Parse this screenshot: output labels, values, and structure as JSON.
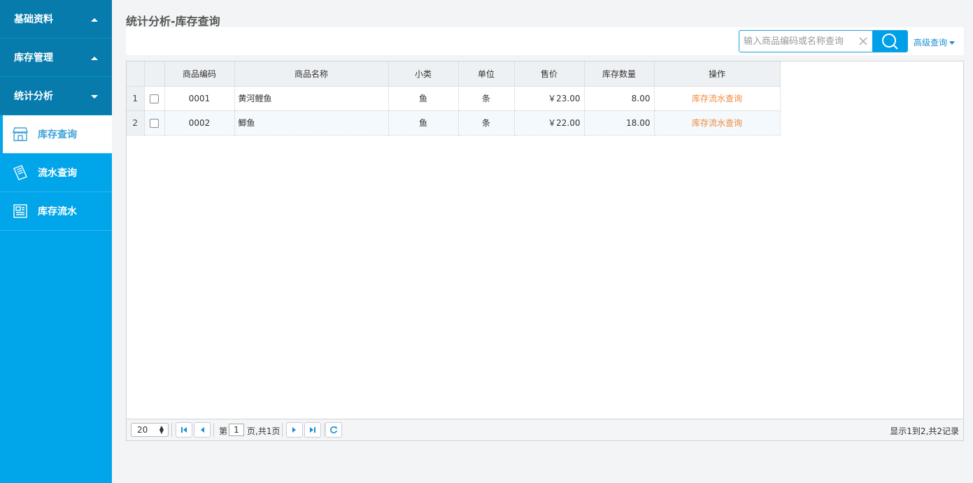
{
  "sidebar": {
    "groups": [
      {
        "label": "基础资料"
      },
      {
        "label": "库存管理"
      },
      {
        "label": "统计分析"
      }
    ],
    "items": [
      {
        "label": "库存查询"
      },
      {
        "label": "流水查询"
      },
      {
        "label": "库存流水"
      }
    ]
  },
  "page": {
    "title": "统计分析-库存查询"
  },
  "search": {
    "placeholder": "输入商品编码或名称查询",
    "advanced_label": "高级查询"
  },
  "table": {
    "headers": [
      "商品编码",
      "商品名称",
      "小类",
      "单位",
      "售价",
      "库存数量",
      "操作"
    ],
    "rows": [
      {
        "rownum": "1",
        "code": "0001",
        "name": "黄河鲤鱼",
        "category": "鱼",
        "unit": "条",
        "price": "￥23.00",
        "qty": "8.00",
        "action": "库存流水查询"
      },
      {
        "rownum": "2",
        "code": "0002",
        "name": "鲫鱼",
        "category": "鱼",
        "unit": "条",
        "price": "￥22.00",
        "qty": "18.00",
        "action": "库存流水查询"
      }
    ]
  },
  "pager": {
    "page_size": "20",
    "page_prefix": "第",
    "page_number": "1",
    "page_suffix": "页,共1页",
    "info": "显示1到2,共2记录"
  },
  "colors": {
    "sidebar": "#01a5e9",
    "sidebar_group": "#067bac",
    "accent": "#00a0e9",
    "action_link": "#ef8a3c"
  }
}
